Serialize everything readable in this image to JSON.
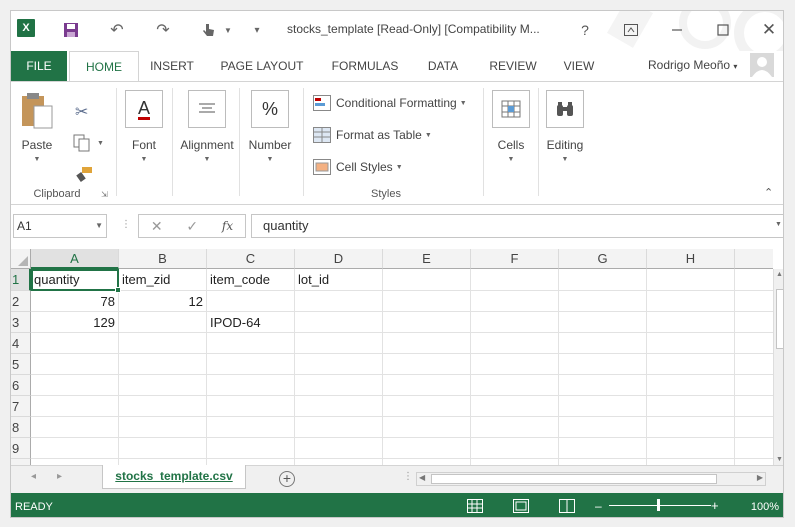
{
  "window": {
    "title": "stocks_template  [Read-Only]  [Compatibility M...",
    "help": "?",
    "close": "✕"
  },
  "ribbon_tabs": [
    "FILE",
    "HOME",
    "INSERT",
    "PAGE LAYOUT",
    "FORMULAS",
    "DATA",
    "REVIEW",
    "VIEW"
  ],
  "user": {
    "name": "Rodrigo Meoño"
  },
  "clipboard": {
    "paste_label": "Paste",
    "group_label": "Clipboard"
  },
  "font": {
    "label": "Font",
    "icon_letter": "A"
  },
  "alignment": {
    "label": "Alignment"
  },
  "number": {
    "label": "Number",
    "icon_symbol": "%"
  },
  "styles": {
    "conditional_formatting": "Conditional Formatting",
    "format_as_table": "Format as Table",
    "cell_styles": "Cell Styles",
    "group_label": "Styles"
  },
  "cells": {
    "label": "Cells"
  },
  "editing": {
    "label": "Editing"
  },
  "formula_bar": {
    "name_box": "A1",
    "fx": "fx",
    "value": "quantity"
  },
  "columns": [
    "A",
    "B",
    "C",
    "D",
    "E",
    "F",
    "G",
    "H"
  ],
  "rows": [
    "1",
    "2",
    "3",
    "4",
    "5",
    "6",
    "7",
    "8",
    "9"
  ],
  "sheet": {
    "row1": {
      "a": "quantity",
      "b": "item_zid",
      "c": "item_code",
      "d": "lot_id"
    },
    "row2": {
      "a": "78",
      "b": "12"
    },
    "row3": {
      "a": "129",
      "c": "IPOD-64"
    }
  },
  "sheet_tab": {
    "name": "stocks_template.csv"
  },
  "status": {
    "text": "READY",
    "zoom": "100%"
  },
  "colors": {
    "accent": "#217346"
  }
}
